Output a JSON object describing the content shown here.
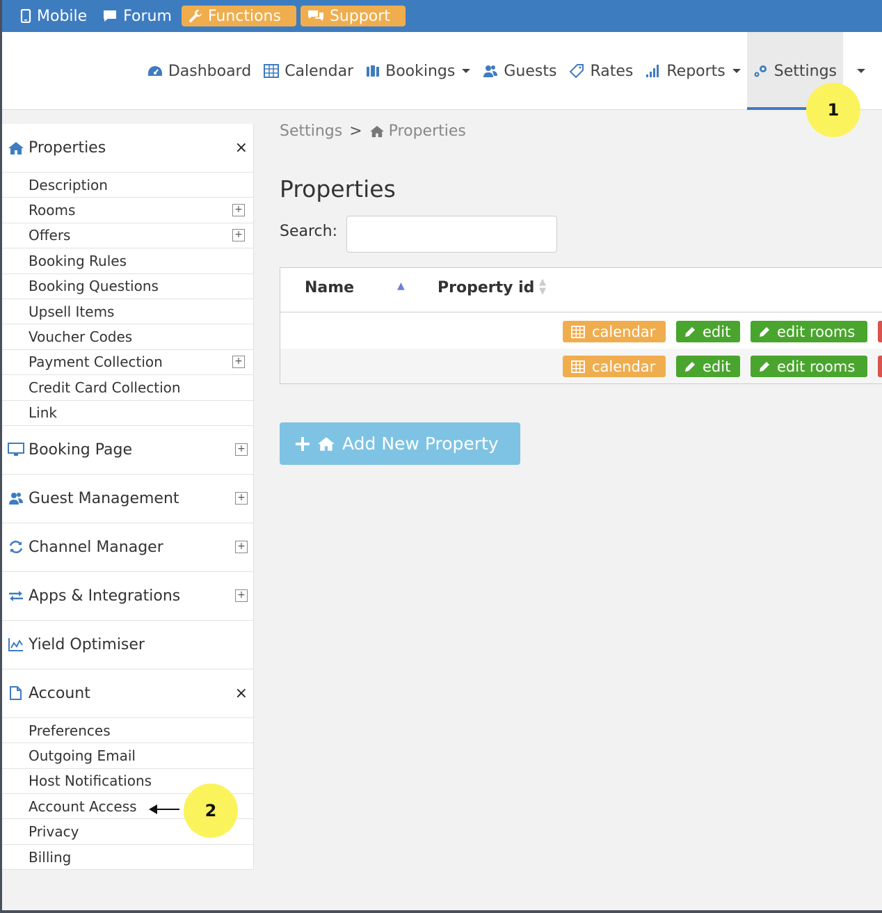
{
  "topbar": {
    "mobile": "Mobile",
    "forum": "Forum",
    "functions": "Functions",
    "support": "Support"
  },
  "nav": {
    "dashboard": "Dashboard",
    "calendar": "Calendar",
    "bookings": "Bookings",
    "guests": "Guests",
    "rates": "Rates",
    "reports": "Reports",
    "settings": "Settings"
  },
  "sidebar": {
    "properties": {
      "title": "Properties",
      "items": [
        "Description",
        "Rooms",
        "Offers",
        "Booking Rules",
        "Booking Questions",
        "Upsell Items",
        "Voucher Codes",
        "Payment Collection",
        "Credit Card Collection",
        "Link"
      ]
    },
    "booking_page": "Booking Page",
    "guest_management": "Guest Management",
    "channel_manager": "Channel Manager",
    "apps": "Apps & Integrations",
    "yield": "Yield Optimiser",
    "account": {
      "title": "Account",
      "items": [
        "Preferences",
        "Outgoing Email",
        "Host Notifications",
        "Account Access",
        "Privacy",
        "Billing"
      ]
    },
    "close_symbol": "×",
    "expand_symbol": "+"
  },
  "breadcrumb": {
    "root": "Settings",
    "sep": ">",
    "current": "Properties"
  },
  "main": {
    "title": "Properties",
    "search_label": "Search:",
    "search_value": "",
    "columns": [
      "Name",
      "Property id"
    ],
    "row_buttons": [
      "calendar",
      "edit",
      "edit rooms"
    ],
    "add_button": "Add New Property"
  },
  "callouts": [
    "1",
    "2"
  ],
  "colors": {
    "brand_blue": "#3e7cc0",
    "orange": "#f0ad4e",
    "green": "#4aa52e",
    "light_blue": "#7ec3e3",
    "callout": "#fbf35c"
  }
}
